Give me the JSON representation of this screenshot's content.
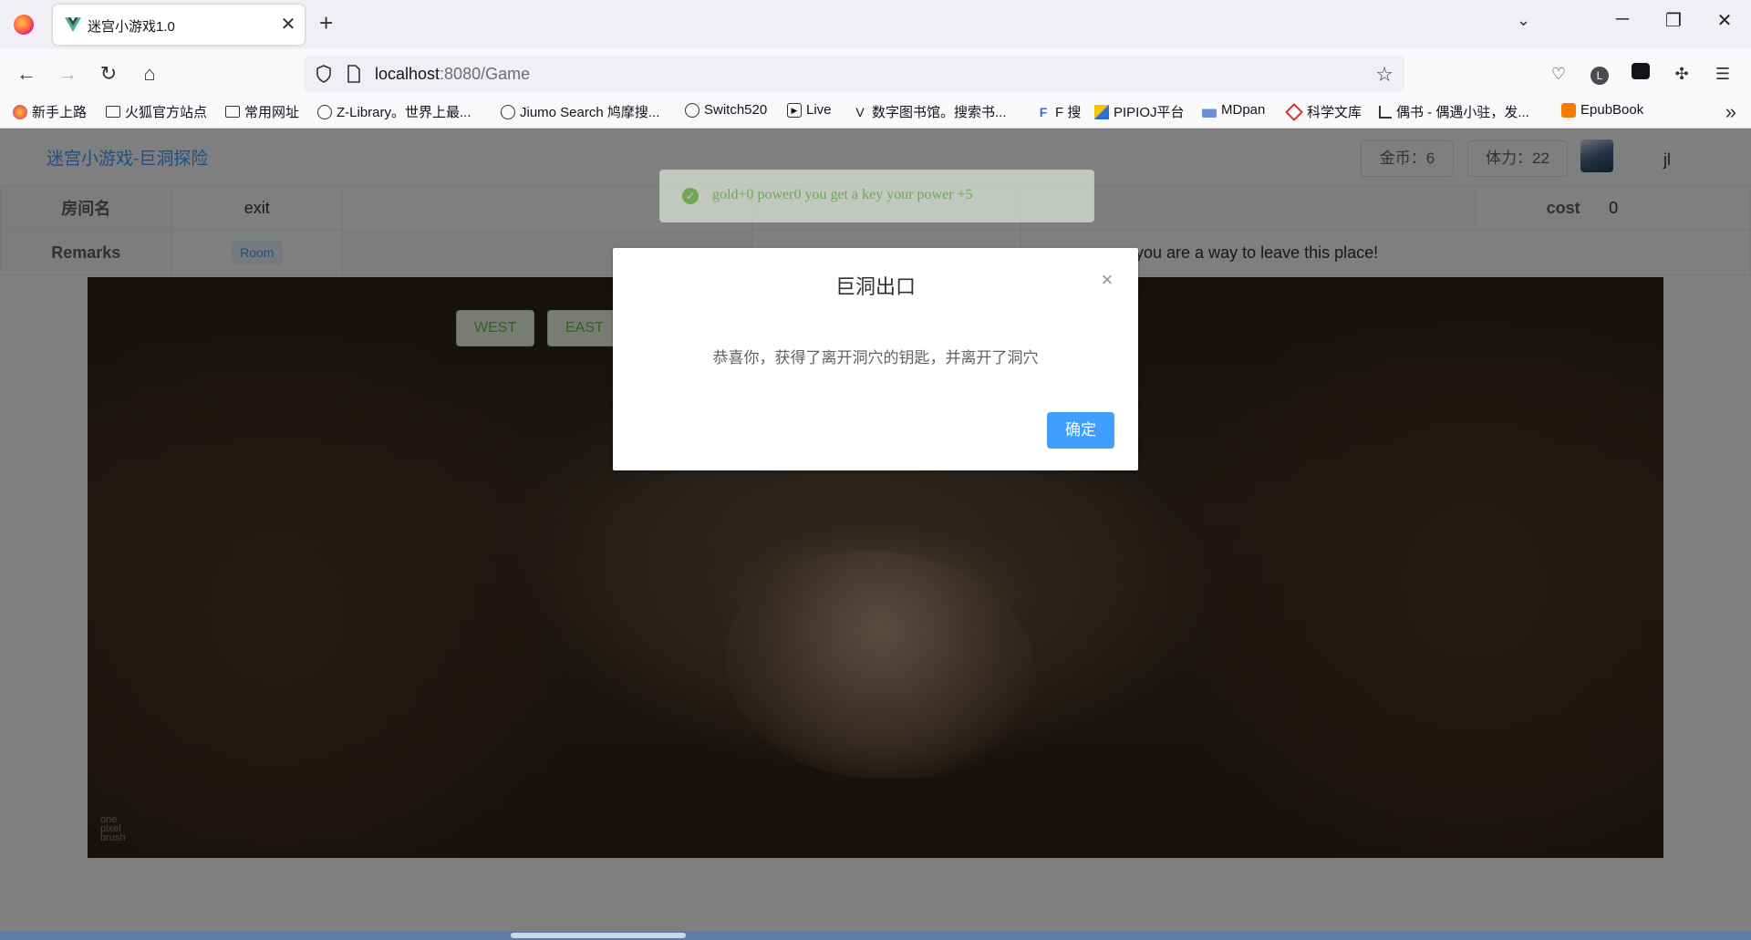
{
  "browser": {
    "tab_title": "迷宫小游戏1.0",
    "tab_close": "✕",
    "new_tab": "+",
    "url_host": "localhost",
    "url_path": ":8080/Game",
    "bookmarks": [
      {
        "label": "新手上路",
        "icon": "firefox-icon"
      },
      {
        "label": "火狐官方站点",
        "icon": "folder-icon"
      },
      {
        "label": "常用网址",
        "icon": "folder-icon"
      },
      {
        "label": "Z-Library。世界上最...",
        "icon": "globe-icon"
      },
      {
        "label": "Jiumo Search 鸠摩搜...",
        "icon": "globe-icon"
      },
      {
        "label": "Switch520",
        "icon": "globe-icon"
      },
      {
        "label": "Live",
        "icon": "play-icon"
      },
      {
        "label": "数字图书馆。搜索书...",
        "icon": "v-logo-icon"
      },
      {
        "label": "F 搜",
        "icon": "f-logo-icon"
      },
      {
        "label": "PIPIOJ平台",
        "icon": "pipioj-icon"
      },
      {
        "label": "MDpan",
        "icon": "mdpan-icon"
      },
      {
        "label": "科学文库",
        "icon": "kexue-icon"
      },
      {
        "label": "偶书 - 偶遇小驻，发...",
        "icon": "oushu-icon"
      },
      {
        "label": "EpubBook",
        "icon": "blogger-icon"
      }
    ]
  },
  "app": {
    "title": "迷宫小游戏-巨洞探险",
    "gold_label": "金币：6",
    "power_label": "体力：22",
    "username": "jl"
  },
  "room": {
    "name_label": "房间名",
    "name_value": "exit",
    "cost_label": "cost",
    "cost_value": "0",
    "remarks_label": "Remarks",
    "remarks_tag": "Room",
    "desc_value_partial": "w,you are a way to leave this place!"
  },
  "directions": [
    "WEST",
    "EAST"
  ],
  "watermark": [
    "one",
    "pixel",
    "brush"
  ],
  "message": {
    "type": "success",
    "text": "gold+0 power0 you get a key your power +5"
  },
  "dialog": {
    "title": "巨洞出口",
    "body": "恭喜你，获得了离开洞穴的钥匙，并离开了洞穴",
    "confirm_label": "确定",
    "close": "×"
  },
  "colors": {
    "primary": "#409eff",
    "success": "#67c23a"
  }
}
